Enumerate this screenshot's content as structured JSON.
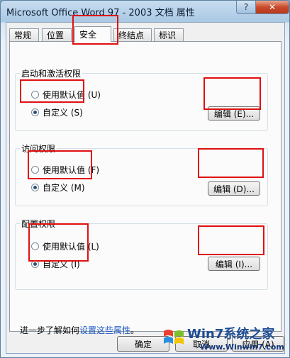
{
  "window": {
    "title": "Microsoft Office Word 97 - 2003 文档 属性",
    "help_glyph": "?",
    "close_glyph": "✕"
  },
  "tabs": [
    {
      "label": "常规",
      "active": false
    },
    {
      "label": "位置",
      "active": false
    },
    {
      "label": "安全",
      "active": true
    },
    {
      "label": "终结点",
      "active": false
    },
    {
      "label": "标识",
      "active": false
    }
  ],
  "groups": {
    "launch": {
      "title": "启动和激活权限",
      "default_label": "使用默认值 (U)",
      "custom_label": "自定义 (S)",
      "edit_label": "编辑 (E)...",
      "selected": "custom"
    },
    "access": {
      "title": "访问权限",
      "default_label": "使用默认值 (F)",
      "custom_label": "自定义 (M)",
      "edit_label": "编辑 (D)...",
      "selected": "custom"
    },
    "config": {
      "title": "配置权限",
      "default_label": "使用默认值 (L)",
      "custom_label": "自定义 (I)",
      "edit_label": "编辑 (I)...",
      "selected": "custom"
    }
  },
  "footer": {
    "prefix": "进一步了解如何",
    "link": "设置这些属性",
    "suffix": "。"
  },
  "buttons": {
    "ok": "确定",
    "cancel": "取消",
    "apply": "应用 (A)"
  },
  "watermark": {
    "main": "Win7系统之家",
    "sub": "Www.Winwin7.com"
  },
  "colors": {
    "highlight": "#e01010",
    "link": "#1a56c4"
  }
}
